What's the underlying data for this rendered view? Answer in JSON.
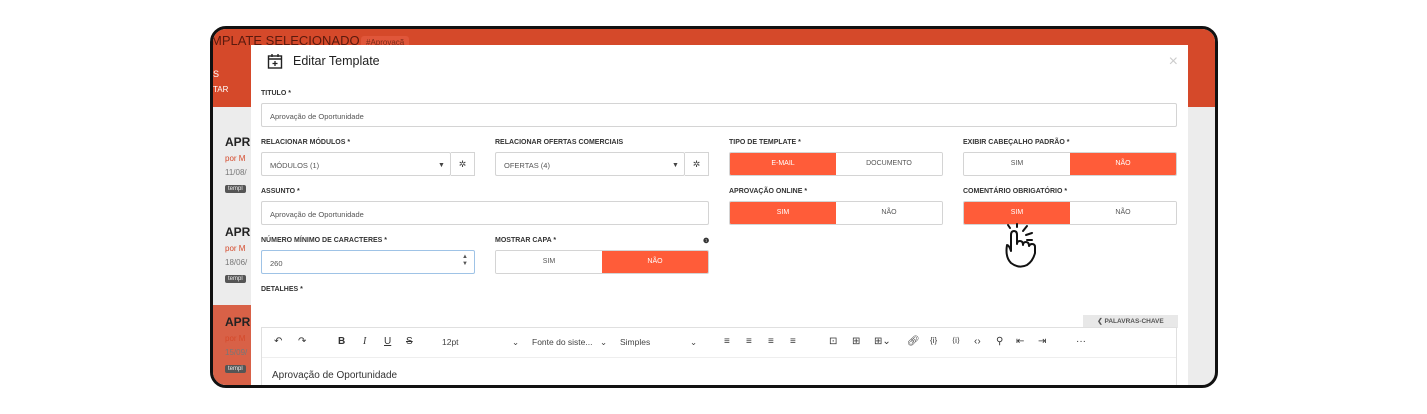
{
  "background": {
    "title": "MPLATE SELECIONADO",
    "badge": "#Aprovaçã",
    "s": "S",
    "tar": "TAR",
    "cards": [
      {
        "t": "APR",
        "p": "por M",
        "d": "11/08/",
        "g": "templ"
      },
      {
        "t": "APR",
        "p": "por M",
        "d": "18/06/",
        "g": "templ"
      },
      {
        "t": "APR",
        "p": "por M",
        "d": "15/09/",
        "g": "templ"
      }
    ]
  },
  "modal": {
    "title": "Editar Template",
    "close": "×",
    "titulo_label": "TITULO *",
    "titulo_value": "Aprovação de Oportunidade",
    "modulos_label": "RELACIONAR MÓDULOS *",
    "modulos_value": "MÓDULOS (1)",
    "ofertas_label": "RELACIONAR OFERTAS COMERCIAIS",
    "ofertas_value": "OFERTAS (4)",
    "tipo_label": "TIPO DE TEMPLATE *",
    "tipo_options": [
      "E-MAIL",
      "DOCUMENTO"
    ],
    "cabecalho_label": "EXIBIR CABEÇALHO PADRÃO *",
    "cabecalho_options": [
      "SIM",
      "NÃO"
    ],
    "assunto_label": "ASSUNTO *",
    "assunto_value": "Aprovação de Oportunidade",
    "aprovacao_label": "APROVAÇÃO ONLINE *",
    "aprovacao_options": [
      "SIM",
      "NÃO"
    ],
    "comentario_label": "COMENTÁRIO OBRIGATÓRIO *",
    "comentario_options": [
      "SIM",
      "NÃO"
    ],
    "numero_label": "NÚMERO MÍNIMO DE CARACTERES *",
    "numero_value": "260",
    "capa_label": "MOSTRAR CAPA *",
    "capa_options": [
      "SIM",
      "NÃO"
    ],
    "detalhes_label": "DETALHES *",
    "keywords_button": "❮ PALAVRAS-CHAVE",
    "editor": {
      "font_size": "12pt",
      "font_family": "Fonte do siste...",
      "format": "Simples",
      "content": "Aprovação de Oportunidade"
    }
  },
  "colors": {
    "accent": "#ff5c39",
    "header_bg": "#d5492a"
  }
}
